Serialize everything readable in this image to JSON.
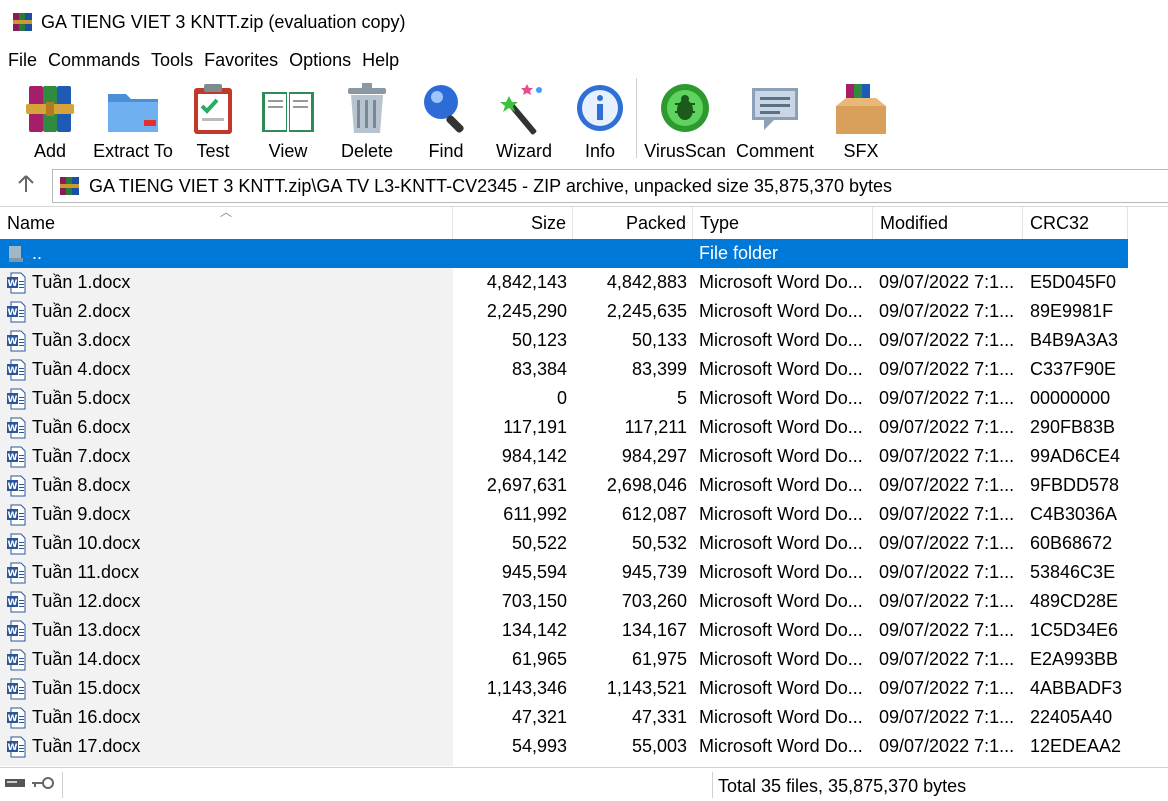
{
  "window": {
    "title": "GA TIENG VIET 3 KNTT.zip (evaluation copy)"
  },
  "menu": [
    "File",
    "Commands",
    "Tools",
    "Favorites",
    "Options",
    "Help"
  ],
  "toolbar": {
    "add": "Add",
    "extract": "Extract To",
    "test": "Test",
    "view": "View",
    "delete": "Delete",
    "find": "Find",
    "wizard": "Wizard",
    "info": "Info",
    "virusscan": "VirusScan",
    "comment": "Comment",
    "sfx": "SFX"
  },
  "address": {
    "text": "GA TIENG VIET 3 KNTT.zip\\GA TV  L3-KNTT-CV2345 - ZIP archive, unpacked size 35,875,370 bytes"
  },
  "columns": {
    "name": "Name",
    "size": "Size",
    "packed": "Packed",
    "type": "Type",
    "modified": "Modified",
    "crc": "CRC32"
  },
  "parent_row": {
    "name": "..",
    "type": "File folder"
  },
  "files": [
    {
      "name": "Tuần 1.docx",
      "size": "4,842,143",
      "packed": "4,842,883",
      "type": "Microsoft Word Do...",
      "modified": "09/07/2022 7:1...",
      "crc": "E5D045F0"
    },
    {
      "name": "Tuần 2.docx",
      "size": "2,245,290",
      "packed": "2,245,635",
      "type": "Microsoft Word Do...",
      "modified": "09/07/2022 7:1...",
      "crc": "89E9981F"
    },
    {
      "name": "Tuần 3.docx",
      "size": "50,123",
      "packed": "50,133",
      "type": "Microsoft Word Do...",
      "modified": "09/07/2022 7:1...",
      "crc": "B4B9A3A3"
    },
    {
      "name": "Tuần 4.docx",
      "size": "83,384",
      "packed": "83,399",
      "type": "Microsoft Word Do...",
      "modified": "09/07/2022 7:1...",
      "crc": "C337F90E"
    },
    {
      "name": "Tuần 5.docx",
      "size": "0",
      "packed": "5",
      "type": "Microsoft Word Do...",
      "modified": "09/07/2022 7:1...",
      "crc": "00000000"
    },
    {
      "name": "Tuần 6.docx",
      "size": "117,191",
      "packed": "117,211",
      "type": "Microsoft Word Do...",
      "modified": "09/07/2022 7:1...",
      "crc": "290FB83B"
    },
    {
      "name": "Tuần 7.docx",
      "size": "984,142",
      "packed": "984,297",
      "type": "Microsoft Word Do...",
      "modified": "09/07/2022 7:1...",
      "crc": "99AD6CE4"
    },
    {
      "name": "Tuần 8.docx",
      "size": "2,697,631",
      "packed": "2,698,046",
      "type": "Microsoft Word Do...",
      "modified": "09/07/2022 7:1...",
      "crc": "9FBDD578"
    },
    {
      "name": "Tuần 9.docx",
      "size": "611,992",
      "packed": "612,087",
      "type": "Microsoft Word Do...",
      "modified": "09/07/2022 7:1...",
      "crc": "C4B3036A"
    },
    {
      "name": "Tuần 10.docx",
      "size": "50,522",
      "packed": "50,532",
      "type": "Microsoft Word Do...",
      "modified": "09/07/2022 7:1...",
      "crc": "60B68672"
    },
    {
      "name": "Tuần 11.docx",
      "size": "945,594",
      "packed": "945,739",
      "type": "Microsoft Word Do...",
      "modified": "09/07/2022 7:1...",
      "crc": "53846C3E"
    },
    {
      "name": "Tuần 12.docx",
      "size": "703,150",
      "packed": "703,260",
      "type": "Microsoft Word Do...",
      "modified": "09/07/2022 7:1...",
      "crc": "489CD28E"
    },
    {
      "name": "Tuần 13.docx",
      "size": "134,142",
      "packed": "134,167",
      "type": "Microsoft Word Do...",
      "modified": "09/07/2022 7:1...",
      "crc": "1C5D34E6"
    },
    {
      "name": "Tuần 14.docx",
      "size": "61,965",
      "packed": "61,975",
      "type": "Microsoft Word Do...",
      "modified": "09/07/2022 7:1...",
      "crc": "E2A993BB"
    },
    {
      "name": "Tuần 15.docx",
      "size": "1,143,346",
      "packed": "1,143,521",
      "type": "Microsoft Word Do...",
      "modified": "09/07/2022 7:1...",
      "crc": "4ABBADF3"
    },
    {
      "name": "Tuần 16.docx",
      "size": "47,321",
      "packed": "47,331",
      "type": "Microsoft Word Do...",
      "modified": "09/07/2022 7:1...",
      "crc": "22405A40"
    },
    {
      "name": "Tuần 17.docx",
      "size": "54,993",
      "packed": "55,003",
      "type": "Microsoft Word Do...",
      "modified": "09/07/2022 7:1...",
      "crc": "12EDEAA2"
    }
  ],
  "status": {
    "total": "Total 35 files, 35,875,370 bytes"
  },
  "colors": {
    "selection": "#0078d7"
  }
}
